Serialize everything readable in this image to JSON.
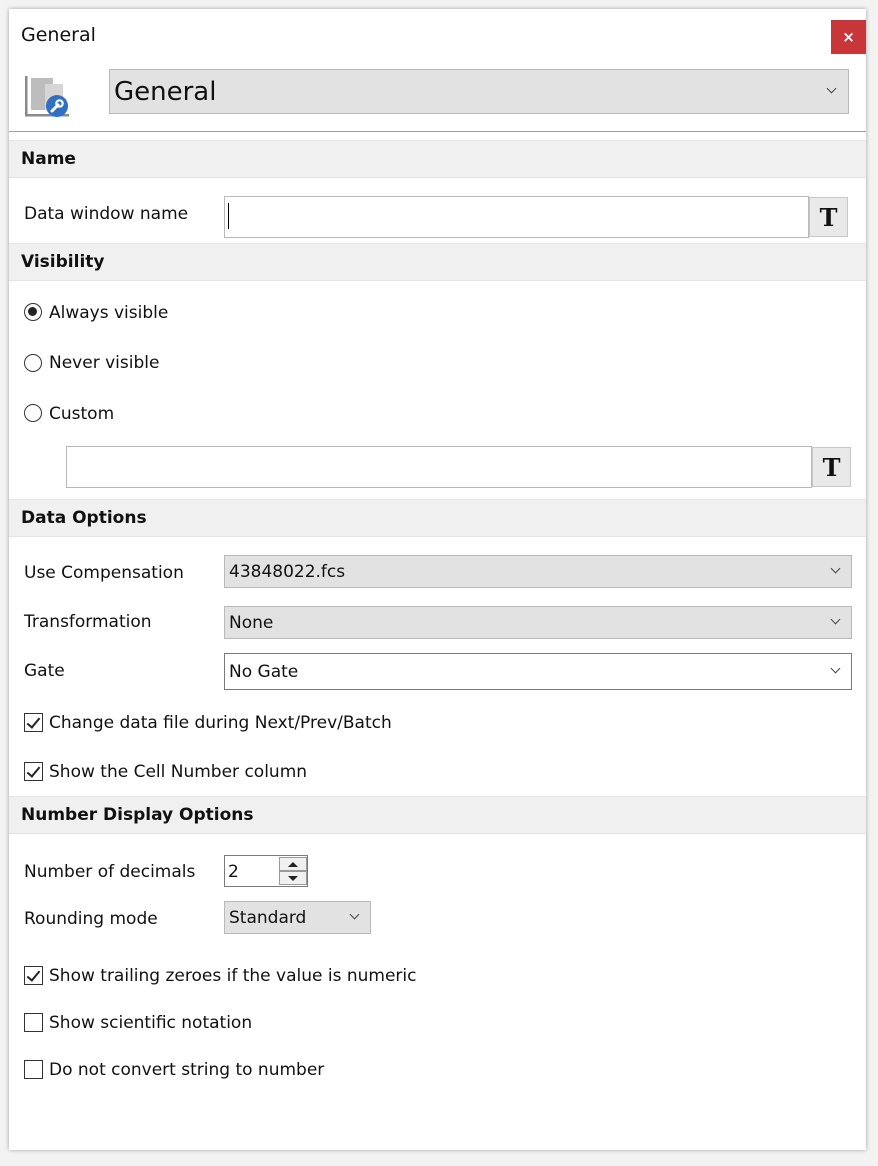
{
  "window": {
    "title": "General",
    "close_label": "×"
  },
  "header": {
    "category_select": "General"
  },
  "sections": {
    "name": "Name",
    "visibility": "Visibility",
    "data_options": "Data Options",
    "number_display": "Number Display Options"
  },
  "name_section": {
    "data_window_name_label": "Data window name",
    "data_window_name_value": "",
    "formula_button": "T"
  },
  "visibility_section": {
    "always_visible": "Always visible",
    "never_visible": "Never visible",
    "custom": "Custom",
    "selected": "always_visible",
    "custom_value": "",
    "formula_button": "T"
  },
  "data_options_section": {
    "use_compensation_label": "Use Compensation",
    "use_compensation_value": "43848022.fcs",
    "transformation_label": "Transformation",
    "transformation_value": "None",
    "gate_label": "Gate",
    "gate_value": "No Gate",
    "change_data_file": {
      "label": "Change data file during Next/Prev/Batch",
      "checked": true
    },
    "show_cell_number": {
      "label": "Show the Cell Number column",
      "checked": true
    }
  },
  "number_display_section": {
    "decimals_label": "Number of decimals",
    "decimals_value": "2",
    "rounding_label": "Rounding mode",
    "rounding_value": "Standard",
    "show_trailing_zeroes": {
      "label": "Show trailing zeroes if the value is numeric",
      "checked": true
    },
    "show_scientific": {
      "label": "Show scientific notation",
      "checked": false
    },
    "no_string_convert": {
      "label": "Do not convert string to number",
      "checked": false
    }
  },
  "colors": {
    "close_button": "#c9363a",
    "icon_accent": "#2f6fc4",
    "section_bg": "#f0f0f0"
  },
  "icons": {
    "app": "document-wrench-icon"
  }
}
